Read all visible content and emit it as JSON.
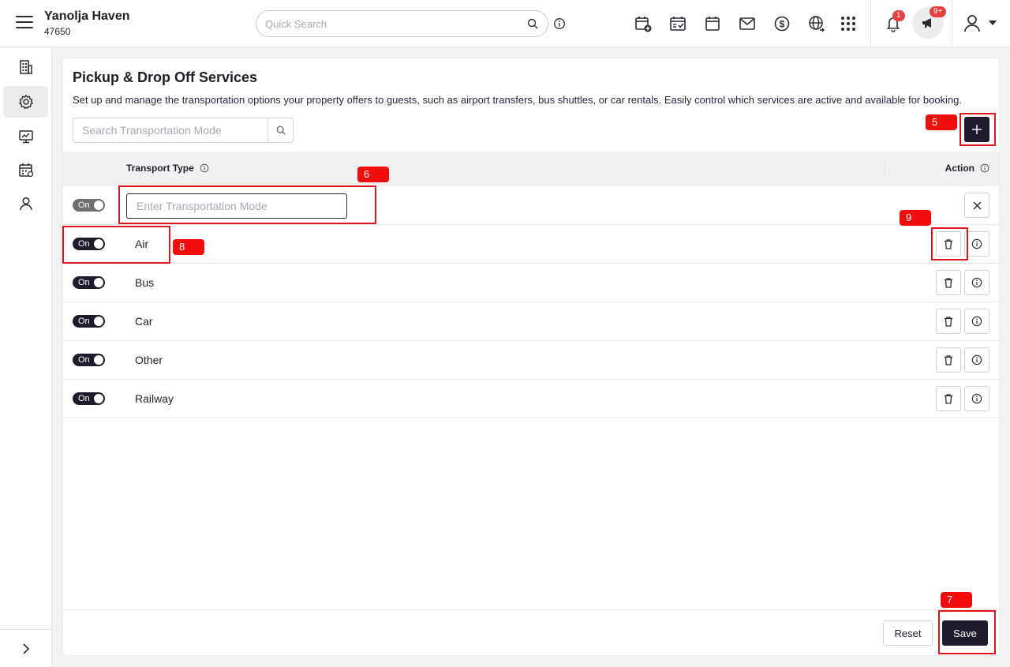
{
  "header": {
    "property_name": "Yanolja Haven",
    "property_code": "47650",
    "search_placeholder": "Quick Search",
    "notification_count": "1",
    "announcement_count": "9+"
  },
  "page": {
    "title": "Pickup & Drop Off Services",
    "description": "Set up and manage the transportation options your property offers to guests, such as airport transfers, bus shuttles, or car rentals. Easily control which services are active and available for booking.",
    "search_placeholder": "Search Transportation Mode",
    "new_row_placeholder": "Enter Transportation Mode"
  },
  "table": {
    "col_type": "Transport Type",
    "col_action": "Action",
    "new_row_toggle": "On",
    "rows": [
      {
        "status": "On",
        "name": "Air"
      },
      {
        "status": "On",
        "name": "Bus"
      },
      {
        "status": "On",
        "name": "Car"
      },
      {
        "status": "On",
        "name": "Other"
      },
      {
        "status": "On",
        "name": "Railway"
      }
    ]
  },
  "footer": {
    "reset_label": "Reset",
    "save_label": "Save"
  },
  "annotations": [
    "5",
    "6",
    "7",
    "8",
    "9"
  ],
  "colors": {
    "accent": "#1e1c2c",
    "annotation": "#e1141b",
    "badge": "#e8403f"
  }
}
